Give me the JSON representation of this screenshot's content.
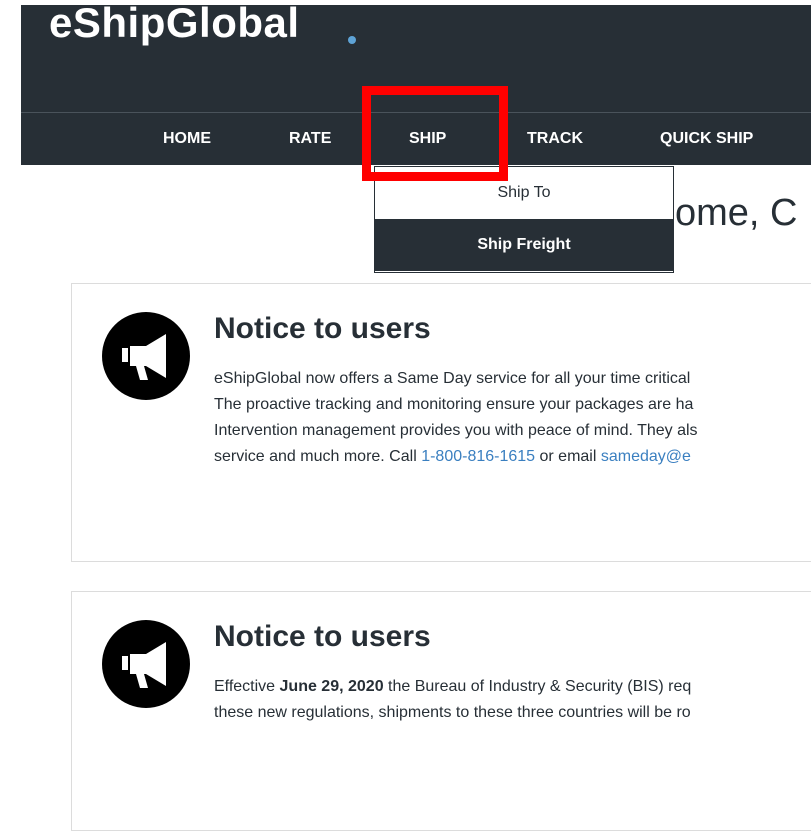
{
  "header": {
    "logo": "eShipGlobal",
    "nav": [
      "HOME",
      "RATE",
      "SHIP",
      "TRACK",
      "QUICK SHIP"
    ]
  },
  "dropdown": {
    "items": [
      "Ship To",
      "Ship Freight"
    ]
  },
  "welcome_fragment": "ome, C",
  "notices": [
    {
      "title": "Notice to users",
      "lines": [
        "eShipGlobal now offers a Same Day service for all your time critical",
        "The proactive tracking and monitoring ensure your packages are ha",
        "Intervention management provides you with peace of mind. They als"
      ],
      "last_line_prefix": "service and much more. Call ",
      "phone": "1-800-816-1615",
      "last_line_mid": " or email ",
      "email": "sameday@e"
    },
    {
      "title": "Notice to users",
      "line1_prefix": "Effective ",
      "line1_bold": "June 29, 2020",
      "line1_suffix": " the Bureau of Industry & Security (BIS) req",
      "line2": "these new regulations, shipments to these three countries will be ro"
    }
  ],
  "icons": {
    "notice_icon": "megaphone-icon"
  },
  "colors": {
    "header_bg": "#272f36",
    "logo_dot": "#5ea3d6",
    "highlight": "#ff0000",
    "link": "#3a7fc0"
  }
}
